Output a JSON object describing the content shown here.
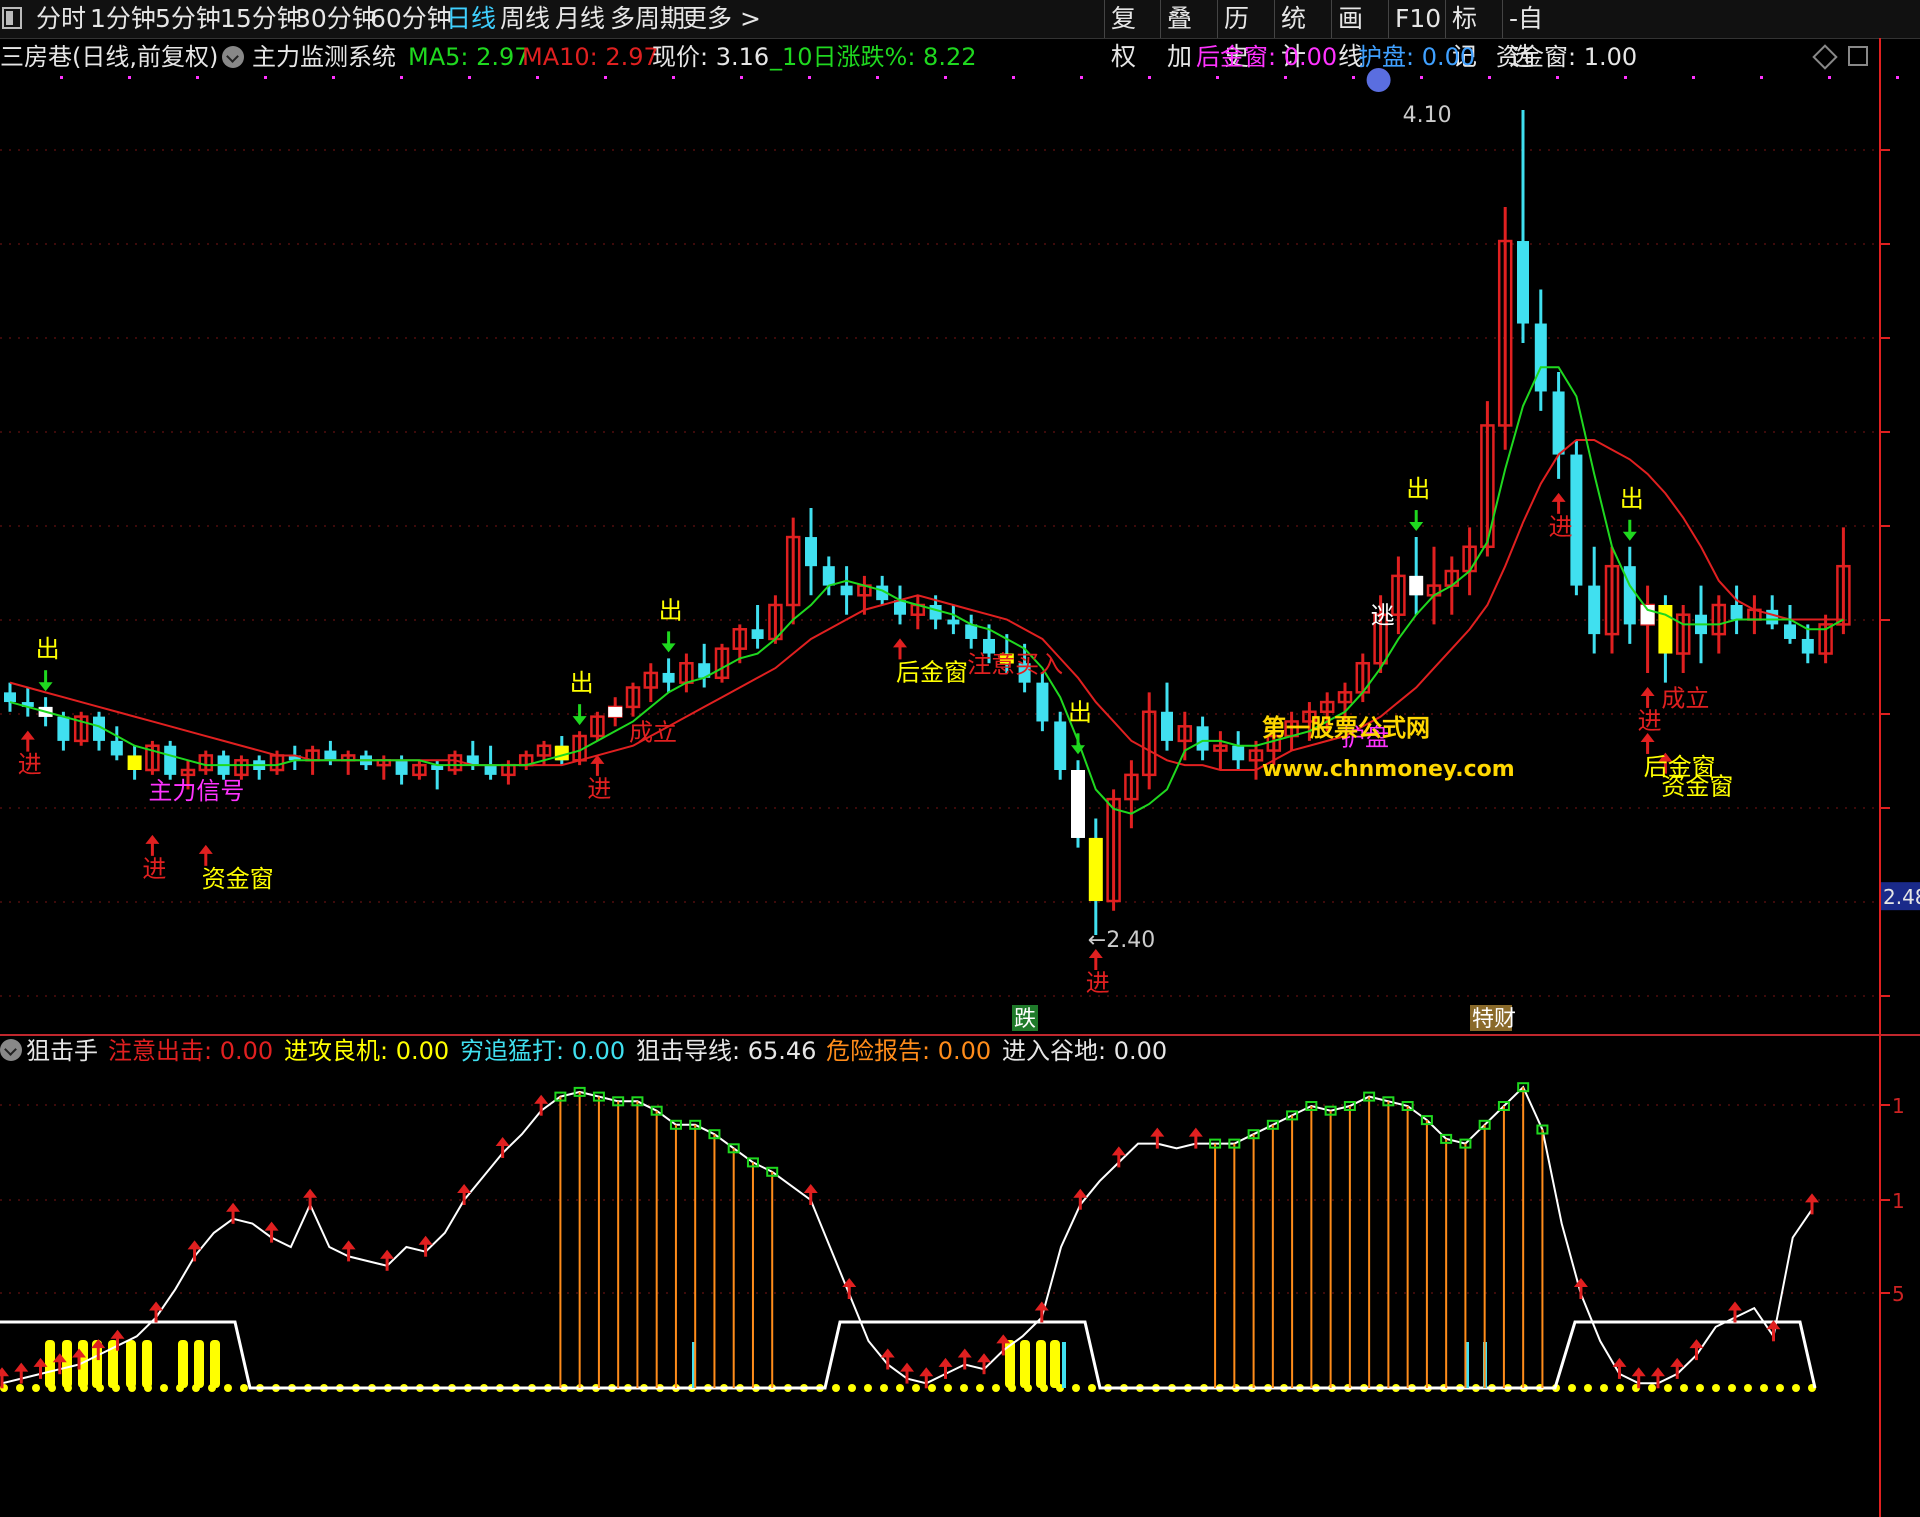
{
  "toolbar": {
    "periods": [
      "分时",
      "1分钟",
      "5分钟",
      "15分钟",
      "30分钟",
      "60分钟",
      "日线",
      "周线",
      "月线",
      "多周期",
      "更多 >"
    ],
    "active": "日线",
    "right_buttons": [
      "复权",
      "叠加",
      "历史",
      "统计",
      "画线",
      "F10",
      "标记",
      "-自选"
    ]
  },
  "main_info": {
    "stock_label": "三房巷(日线,前复权)",
    "indicator_name": "主力监测系统",
    "ma5_label": "MA5: 2.97",
    "ma10_label": "MA10: 2.97",
    "price_label": "现价: 3.16",
    "change_label": "_10日涨跌%: 8.22",
    "houjinchuang_label": "后金窗: 0.00",
    "hupan_label": "护盘: 0.00",
    "zijinchuang_label": "资金窗: 1.00"
  },
  "sub_info": {
    "indicator_name": "狙击手",
    "v1": "注意出击: 0.00",
    "v2": "进攻良机: 0.00",
    "v3": "穷追猛打: 0.00",
    "v4": "狙击导线: 65.46",
    "v5": "危险报告: 0.00",
    "v6": "进入谷地: 0.00"
  },
  "watermark": {
    "line1": "第一股票公式网",
    "line2": "www.chnmoney.com"
  },
  "axis": {
    "price_tag": "2.48",
    "sub_ticks": [
      "1",
      "1",
      "5"
    ]
  },
  "extremes": {
    "high_label": "4.10",
    "low_label": "2.40",
    "low_prefix": "←"
  },
  "event_badges": [
    {
      "text": "跌",
      "color": "#1f7a2a"
    },
    {
      "text": "特财",
      "color": "#8a6a2a"
    }
  ],
  "colors": {
    "up": "#e02020",
    "down": "#40e0f0",
    "signal_yellow": "#ffff00",
    "signal_white": "#ffffff",
    "ma5": "#1fd81f",
    "ma10": "#e02020",
    "magenta": "#ff33ff",
    "sub_line": "#ffffff",
    "orange": "#ff8c1a"
  },
  "chart_data": {
    "type": "candlestick",
    "price_axis": {
      "min": 2.4,
      "max": 4.1
    },
    "candles": [
      [
        2.9,
        2.92,
        2.86,
        2.88
      ],
      [
        2.88,
        2.91,
        2.85,
        2.87
      ],
      [
        2.87,
        2.89,
        2.83,
        2.85
      ],
      [
        2.85,
        2.86,
        2.78,
        2.8
      ],
      [
        2.8,
        2.86,
        2.79,
        2.85
      ],
      [
        2.85,
        2.86,
        2.78,
        2.8
      ],
      [
        2.8,
        2.83,
        2.76,
        2.77
      ],
      [
        2.77,
        2.79,
        2.72,
        2.74
      ],
      [
        2.74,
        2.8,
        2.73,
        2.79
      ],
      [
        2.79,
        2.8,
        2.72,
        2.73
      ],
      [
        2.73,
        2.76,
        2.7,
        2.74
      ],
      [
        2.74,
        2.78,
        2.73,
        2.77
      ],
      [
        2.77,
        2.78,
        2.72,
        2.73
      ],
      [
        2.73,
        2.77,
        2.72,
        2.76
      ],
      [
        2.76,
        2.77,
        2.72,
        2.74
      ],
      [
        2.74,
        2.78,
        2.73,
        2.77
      ],
      [
        2.77,
        2.79,
        2.74,
        2.76
      ],
      [
        2.76,
        2.79,
        2.73,
        2.78
      ],
      [
        2.78,
        2.8,
        2.75,
        2.76
      ],
      [
        2.76,
        2.78,
        2.73,
        2.77
      ],
      [
        2.77,
        2.78,
        2.74,
        2.75
      ],
      [
        2.75,
        2.77,
        2.72,
        2.76
      ],
      [
        2.76,
        2.77,
        2.71,
        2.73
      ],
      [
        2.73,
        2.76,
        2.72,
        2.75
      ],
      [
        2.75,
        2.76,
        2.7,
        2.74
      ],
      [
        2.74,
        2.78,
        2.73,
        2.77
      ],
      [
        2.77,
        2.8,
        2.74,
        2.75
      ],
      [
        2.75,
        2.79,
        2.72,
        2.73
      ],
      [
        2.73,
        2.76,
        2.71,
        2.75
      ],
      [
        2.75,
        2.78,
        2.74,
        2.77
      ],
      [
        2.77,
        2.8,
        2.75,
        2.79
      ],
      [
        2.79,
        2.81,
        2.75,
        2.76
      ],
      [
        2.76,
        2.82,
        2.75,
        2.81
      ],
      [
        2.81,
        2.86,
        2.8,
        2.85
      ],
      [
        2.85,
        2.89,
        2.83,
        2.87
      ],
      [
        2.87,
        2.92,
        2.85,
        2.91
      ],
      [
        2.91,
        2.96,
        2.88,
        2.94
      ],
      [
        2.94,
        2.97,
        2.9,
        2.92
      ],
      [
        2.92,
        2.98,
        2.9,
        2.96
      ],
      [
        2.96,
        3.0,
        2.91,
        2.93
      ],
      [
        2.93,
        3.0,
        2.92,
        2.99
      ],
      [
        2.99,
        3.04,
        2.96,
        3.03
      ],
      [
        3.03,
        3.08,
        2.99,
        3.01
      ],
      [
        3.01,
        3.1,
        3.0,
        3.08
      ],
      [
        3.08,
        3.26,
        3.04,
        3.22
      ],
      [
        3.22,
        3.28,
        3.1,
        3.16
      ],
      [
        3.16,
        3.18,
        3.1,
        3.12
      ],
      [
        3.12,
        3.16,
        3.06,
        3.1
      ],
      [
        3.1,
        3.14,
        3.06,
        3.12
      ],
      [
        3.12,
        3.14,
        3.08,
        3.09
      ],
      [
        3.09,
        3.12,
        3.04,
        3.06
      ],
      [
        3.06,
        3.1,
        3.03,
        3.08
      ],
      [
        3.08,
        3.1,
        3.03,
        3.05
      ],
      [
        3.05,
        3.08,
        3.02,
        3.04
      ],
      [
        3.04,
        3.06,
        2.99,
        3.01
      ],
      [
        3.01,
        3.04,
        2.96,
        2.98
      ],
      [
        2.98,
        3.02,
        2.94,
        2.96
      ],
      [
        2.96,
        3.0,
        2.9,
        2.92
      ],
      [
        2.92,
        2.94,
        2.82,
        2.84
      ],
      [
        2.84,
        2.86,
        2.72,
        2.74
      ],
      [
        2.74,
        2.76,
        2.58,
        2.6
      ],
      [
        2.6,
        2.64,
        2.4,
        2.47
      ],
      [
        2.47,
        2.7,
        2.45,
        2.68
      ],
      [
        2.68,
        2.76,
        2.62,
        2.73
      ],
      [
        2.73,
        2.9,
        2.7,
        2.86
      ],
      [
        2.86,
        2.92,
        2.78,
        2.8
      ],
      [
        2.8,
        2.86,
        2.76,
        2.83
      ],
      [
        2.83,
        2.85,
        2.76,
        2.78
      ],
      [
        2.78,
        2.82,
        2.74,
        2.79
      ],
      [
        2.79,
        2.82,
        2.74,
        2.76
      ],
      [
        2.76,
        2.8,
        2.72,
        2.78
      ],
      [
        2.78,
        2.82,
        2.75,
        2.81
      ],
      [
        2.81,
        2.86,
        2.78,
        2.84
      ],
      [
        2.84,
        2.88,
        2.8,
        2.86
      ],
      [
        2.86,
        2.9,
        2.82,
        2.88
      ],
      [
        2.88,
        2.92,
        2.84,
        2.9
      ],
      [
        2.9,
        2.98,
        2.88,
        2.96
      ],
      [
        2.96,
        3.1,
        2.94,
        3.06
      ],
      [
        3.06,
        3.18,
        3.02,
        3.14
      ],
      [
        3.14,
        3.22,
        3.06,
        3.1
      ],
      [
        3.1,
        3.2,
        3.04,
        3.12
      ],
      [
        3.12,
        3.18,
        3.06,
        3.15
      ],
      [
        3.15,
        3.24,
        3.1,
        3.2
      ],
      [
        3.2,
        3.5,
        3.18,
        3.45
      ],
      [
        3.45,
        3.9,
        3.4,
        3.83
      ],
      [
        3.83,
        4.1,
        3.62,
        3.66
      ],
      [
        3.66,
        3.73,
        3.48,
        3.52
      ],
      [
        3.52,
        3.56,
        3.34,
        3.39
      ],
      [
        3.39,
        3.42,
        3.1,
        3.12
      ],
      [
        3.12,
        3.2,
        2.98,
        3.02
      ],
      [
        3.02,
        3.2,
        2.98,
        3.16
      ],
      [
        3.16,
        3.2,
        3.0,
        3.04
      ],
      [
        3.04,
        3.12,
        2.94,
        3.08
      ],
      [
        3.08,
        3.1,
        2.92,
        2.98
      ],
      [
        2.98,
        3.08,
        2.94,
        3.06
      ],
      [
        3.06,
        3.12,
        2.96,
        3.02
      ],
      [
        3.02,
        3.1,
        2.98,
        3.08
      ],
      [
        3.08,
        3.12,
        3.02,
        3.05
      ],
      [
        3.05,
        3.1,
        3.02,
        3.07
      ],
      [
        3.07,
        3.1,
        3.03,
        3.04
      ],
      [
        3.04,
        3.08,
        3.0,
        3.01
      ],
      [
        3.01,
        3.04,
        2.96,
        2.98
      ],
      [
        2.98,
        3.06,
        2.96,
        3.04
      ],
      [
        3.04,
        3.24,
        3.02,
        3.16
      ]
    ],
    "ma5": [
      2.88,
      2.87,
      2.86,
      2.85,
      2.84,
      2.83,
      2.81,
      2.79,
      2.78,
      2.77,
      2.76,
      2.75,
      2.75,
      2.75,
      2.75,
      2.75,
      2.76,
      2.76,
      2.76,
      2.76,
      2.76,
      2.76,
      2.76,
      2.76,
      2.75,
      2.75,
      2.75,
      2.75,
      2.75,
      2.75,
      2.76,
      2.77,
      2.78,
      2.8,
      2.82,
      2.84,
      2.87,
      2.9,
      2.92,
      2.93,
      2.95,
      2.97,
      2.98,
      3.01,
      3.05,
      3.08,
      3.12,
      3.13,
      3.12,
      3.11,
      3.09,
      3.08,
      3.07,
      3.06,
      3.04,
      3.03,
      3.01,
      2.99,
      2.95,
      2.89,
      2.8,
      2.7,
      2.66,
      2.65,
      2.67,
      2.7,
      2.78,
      2.8,
      2.8,
      2.79,
      2.79,
      2.8,
      2.81,
      2.82,
      2.84,
      2.86,
      2.9,
      2.95,
      3.01,
      3.06,
      3.1,
      3.12,
      3.15,
      3.21,
      3.36,
      3.49,
      3.57,
      3.57,
      3.51,
      3.35,
      3.2,
      3.12,
      3.07,
      3.06,
      3.04,
      3.04,
      3.04,
      3.05,
      3.05,
      3.05,
      3.05,
      3.03,
      3.03,
      3.05
    ],
    "ma10": [
      2.92,
      2.91,
      2.9,
      2.89,
      2.88,
      2.87,
      2.86,
      2.85,
      2.84,
      2.83,
      2.82,
      2.81,
      2.8,
      2.79,
      2.78,
      2.77,
      2.77,
      2.76,
      2.76,
      2.76,
      2.76,
      2.76,
      2.76,
      2.76,
      2.76,
      2.76,
      2.75,
      2.75,
      2.75,
      2.75,
      2.75,
      2.75,
      2.76,
      2.77,
      2.78,
      2.79,
      2.81,
      2.83,
      2.85,
      2.87,
      2.89,
      2.91,
      2.93,
      2.95,
      2.98,
      3.01,
      3.03,
      3.05,
      3.07,
      3.08,
      3.09,
      3.1,
      3.09,
      3.08,
      3.07,
      3.06,
      3.05,
      3.03,
      3.01,
      2.97,
      2.93,
      2.88,
      2.84,
      2.8,
      2.78,
      2.76,
      2.75,
      2.75,
      2.74,
      2.74,
      2.74,
      2.76,
      2.78,
      2.79,
      2.8,
      2.81,
      2.83,
      2.85,
      2.88,
      2.91,
      2.95,
      2.99,
      3.03,
      3.08,
      3.16,
      3.25,
      3.33,
      3.39,
      3.42,
      3.42,
      3.4,
      3.38,
      3.35,
      3.31,
      3.26,
      3.2,
      3.13,
      3.09,
      3.07,
      3.06,
      3.05,
      3.05,
      3.05,
      3.05
    ],
    "signals": [
      {
        "i": 2,
        "type": "出",
        "pos": "above",
        "color": "#ffff00",
        "arrow": "down",
        "arrow_color": "#1fd81f"
      },
      {
        "i": 1,
        "type": "进",
        "pos": "below",
        "color": "#e02020",
        "arrow": "up"
      },
      {
        "i": 8,
        "type": "进",
        "pos": "below2",
        "color": "#e02020",
        "arrow": "up"
      },
      {
        "i": 8,
        "type": "主力信号",
        "pos": "label",
        "color": "#ff33ff"
      },
      {
        "i": 11,
        "type": "资金窗",
        "pos": "below3",
        "color": "#ffff00",
        "arrow": "up"
      },
      {
        "i": 32,
        "type": "出",
        "pos": "above",
        "color": "#ffff00",
        "arrow": "down",
        "arrow_color": "#1fd81f"
      },
      {
        "i": 33,
        "type": "进",
        "pos": "below",
        "color": "#e02020",
        "arrow": "up"
      },
      {
        "i": 35,
        "type": "成立",
        "pos": "label",
        "color": "#e02020"
      },
      {
        "i": 37,
        "type": "出",
        "pos": "above",
        "color": "#ffff00",
        "arrow": "down",
        "arrow_color": "#1fd81f"
      },
      {
        "i": 50,
        "type": "后金窗",
        "pos": "below",
        "color": "#ffff00",
        "arrow": "up"
      },
      {
        "i": 54,
        "type": "注意买入",
        "pos": "label",
        "color": "#e02020",
        "arrow": "up"
      },
      {
        "i": 60,
        "type": "出",
        "pos": "above",
        "color": "#ffff00",
        "arrow": "down",
        "arrow_color": "#1fd81f"
      },
      {
        "i": 61,
        "type": "进",
        "pos": "below",
        "color": "#e02020",
        "arrow": "up"
      },
      {
        "i": 75,
        "type": "护盘",
        "pos": "label",
        "color": "#ff33ff",
        "arrow": "up"
      },
      {
        "i": 77,
        "type": "逃",
        "pos": "top",
        "color": "#ffffff"
      },
      {
        "i": 79,
        "type": "出",
        "pos": "above",
        "color": "#ffff00",
        "arrow": "down",
        "arrow_color": "#1fd81f"
      },
      {
        "i": 87,
        "type": "进",
        "pos": "below",
        "color": "#e02020",
        "arrow": "up"
      },
      {
        "i": 91,
        "type": "出",
        "pos": "above",
        "color": "#ffff00",
        "arrow": "down",
        "arrow_color": "#1fd81f"
      },
      {
        "i": 93,
        "type": "成立",
        "pos": "label",
        "color": "#e02020"
      },
      {
        "i": 93,
        "type": "资金窗",
        "pos": "below3",
        "color": "#ffff00",
        "arrow": "up"
      },
      {
        "i": 92,
        "type": "进",
        "pos": "below",
        "color": "#e02020",
        "arrow": "up"
      },
      {
        "i": 92,
        "type": "后金窗",
        "pos": "below2",
        "color": "#ffff00",
        "arrow": "up"
      }
    ],
    "sniper_line": [
      2,
      4,
      6,
      8,
      10,
      14,
      18,
      22,
      30,
      42,
      56,
      66,
      72,
      70,
      64,
      60,
      78,
      60,
      56,
      54,
      52,
      60,
      58,
      66,
      80,
      90,
      100,
      108,
      118,
      124,
      126,
      124,
      122,
      122,
      118,
      112,
      112,
      108,
      102,
      96,
      92,
      86,
      80,
      60,
      40,
      20,
      10,
      4,
      2,
      6,
      10,
      8,
      16,
      22,
      30,
      60,
      78,
      88,
      96,
      104,
      104,
      102,
      104,
      104,
      104,
      108,
      112,
      116,
      120,
      118,
      120,
      124,
      122,
      120,
      114,
      106,
      104,
      112,
      120,
      128,
      110,
      70,
      40,
      20,
      6,
      2,
      2,
      6,
      14,
      26,
      30,
      34,
      22,
      64,
      76
    ]
  }
}
